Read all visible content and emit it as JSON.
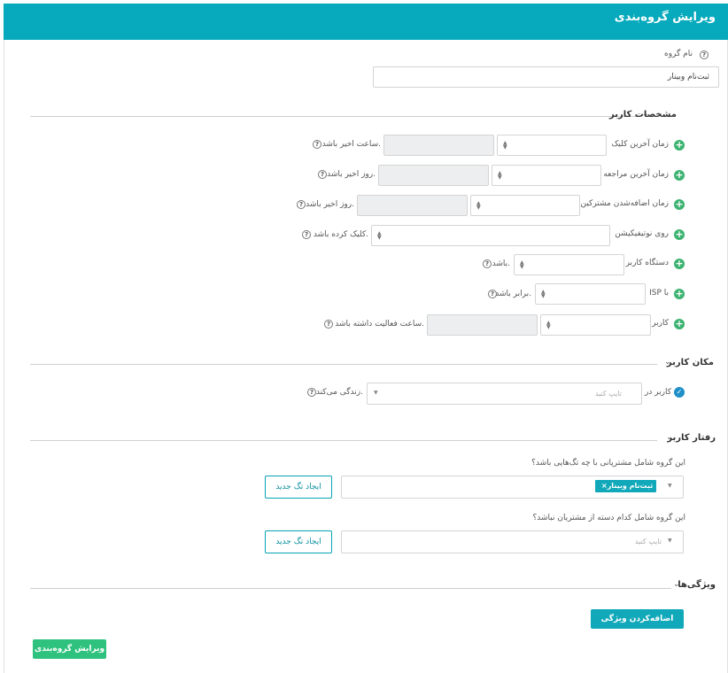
{
  "header": {
    "title": "ویرایش گروه‌بندی"
  },
  "group_name": {
    "label": "نام گروه",
    "value": "ثبت‌نام وبینار"
  },
  "sections": {
    "user_specs": "مشخصات کاربر",
    "user_location": "مکان کاربر",
    "user_behavior": "رفتار کاربر",
    "features": "ویژگی‌ها"
  },
  "specs_rows": [
    {
      "label": "زمان آخرین کلیک",
      "suffix": "ساعت اخیر باشد."
    },
    {
      "label": "زمان آخرین مراجعه",
      "suffix": "روز اخیر باشد."
    },
    {
      "label": "زمان اضافه‌شدن مشترکین",
      "suffix": "روز اخیر باشد."
    },
    {
      "label": "روی نوتیفیکیشن",
      "suffix": "کلیک کرده باشد."
    },
    {
      "label": "دستگاه کاربر",
      "suffix": "باشد."
    },
    {
      "label": "ISP با",
      "suffix": "برابر باشد."
    },
    {
      "label": "کاربر",
      "suffix": "ساعت فعالیت داشته باشد."
    }
  ],
  "location": {
    "label": "کاربر در",
    "placeholder": "تایپ کنید",
    "suffix": "زندگی می‌کند."
  },
  "behavior": {
    "q1": "این گروه شامل مشترپانی با چه تگ‌هایی باشد؟",
    "q1_tag": "ثبت‌نام وبینار",
    "q2": "این گروه شامل کدام دسته از مشتریان نباشد؟",
    "q2_placeholder": "تایپ کنید",
    "create_tag_label": "ایجاد تگ جدید"
  },
  "buttons": {
    "add_feature": "اضافه‌کردن ویژگی جدید",
    "submit": "ویرایش گروه‌بندی"
  },
  "icons": {
    "help": "help-circle-icon",
    "add": "plus-circle-icon",
    "check": "check-circle-icon",
    "chevron": "chevron-down-icon",
    "caret": "caret-updown-icon",
    "tag_remove": "close-icon"
  },
  "colors": {
    "header_bg": "#06aabc",
    "plus_icon": "#3cb371",
    "check_icon": "#1f8fc8",
    "teal_button": "#11a9ba",
    "submit_button": "#2ec27e"
  }
}
